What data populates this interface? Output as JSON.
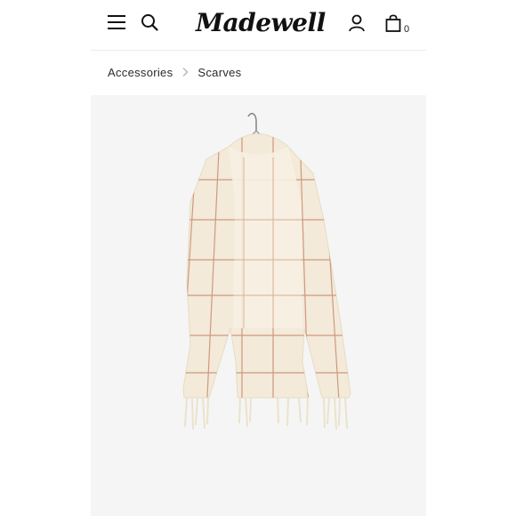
{
  "header": {
    "brand": "Madewell",
    "cart_count": "0",
    "icons": [
      "menu-icon",
      "search-icon",
      "account-icon",
      "shopping-bag-icon"
    ]
  },
  "breadcrumb": {
    "items": [
      "Accessories",
      "Scarves"
    ],
    "separator_icon": "chevron-right-icon"
  },
  "product_image": {
    "subject": "scarf-on-hanger",
    "colors": {
      "background": "#f5f5f5",
      "fabric": "#f3ead9",
      "grid_line": "#c98a6e"
    }
  }
}
